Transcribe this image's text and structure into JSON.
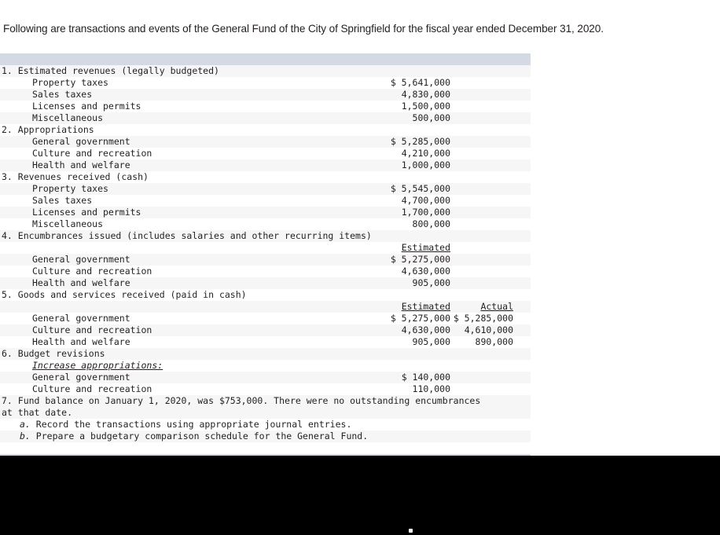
{
  "intro": {
    "text": "Following are transactions and events of the General Fund of the City of Springfield for the fiscal year ended December 31, 2020."
  },
  "colors": {
    "header_bar": "#d4d9e3",
    "stripe": "#f6f6f6",
    "text": "#231f20",
    "video_area": "#000000"
  },
  "table": {
    "headers": {
      "estimated": "Estimated",
      "actual": "Actual"
    },
    "rows": [
      {
        "label": "1. Estimated revenues (legally budgeted)"
      },
      {
        "label": "Property taxes",
        "amount": "$ 5,641,000"
      },
      {
        "label": "Sales taxes",
        "amount": "4,830,000"
      },
      {
        "label": "Licenses and permits",
        "amount": "1,500,000"
      },
      {
        "label": "Miscellaneous",
        "amount": "500,000"
      },
      {
        "label": "2. Appropriations"
      },
      {
        "label": "General government",
        "amount": "$ 5,285,000"
      },
      {
        "label": "Culture and recreation",
        "amount": "4,210,000"
      },
      {
        "label": "Health and welfare",
        "amount": "1,000,000"
      },
      {
        "label": "3. Revenues received (cash)"
      },
      {
        "label": "Property taxes",
        "amount": "$ 5,545,000"
      },
      {
        "label": "Sales taxes",
        "amount": "4,700,000"
      },
      {
        "label": "Licenses and permits",
        "amount": "1,700,000"
      },
      {
        "label": "Miscellaneous",
        "amount": "800,000"
      },
      {
        "label": "4. Encumbrances issued (includes salaries and other recurring items)"
      },
      {
        "label": "",
        "estimated_header": "Estimated"
      },
      {
        "label": "General government",
        "amount": "$ 5,275,000"
      },
      {
        "label": "Culture and recreation",
        "amount": "4,630,000"
      },
      {
        "label": "Health and welfare",
        "amount": "905,000"
      },
      {
        "label": "5. Goods and services received (paid in cash)"
      },
      {
        "label": "",
        "estimated_header": "Estimated",
        "actual_header": "Actual"
      },
      {
        "label": "General government",
        "estimated": "$ 5,275,000",
        "actual": "$ 5,285,000"
      },
      {
        "label": "Culture and recreation",
        "estimated": "4,630,000",
        "actual": "4,610,000"
      },
      {
        "label": "Health and welfare",
        "estimated": "905,000",
        "actual": "890,000"
      },
      {
        "label": "6. Budget revisions"
      },
      {
        "label": "Increase appropriations:"
      },
      {
        "label": "General government",
        "amount": "$ 140,000"
      },
      {
        "label": "Culture and recreation",
        "amount": "110,000"
      },
      {
        "label": "7. Fund balance on January 1, 2020, was $753,000. There were no outstanding encumbrances",
        "line2": "at that date."
      },
      {
        "marker": "a.",
        "label": "Record the transactions using appropriate journal entries."
      },
      {
        "marker": "b.",
        "label": "Prepare a budgetary comparison schedule for the General Fund."
      }
    ]
  }
}
